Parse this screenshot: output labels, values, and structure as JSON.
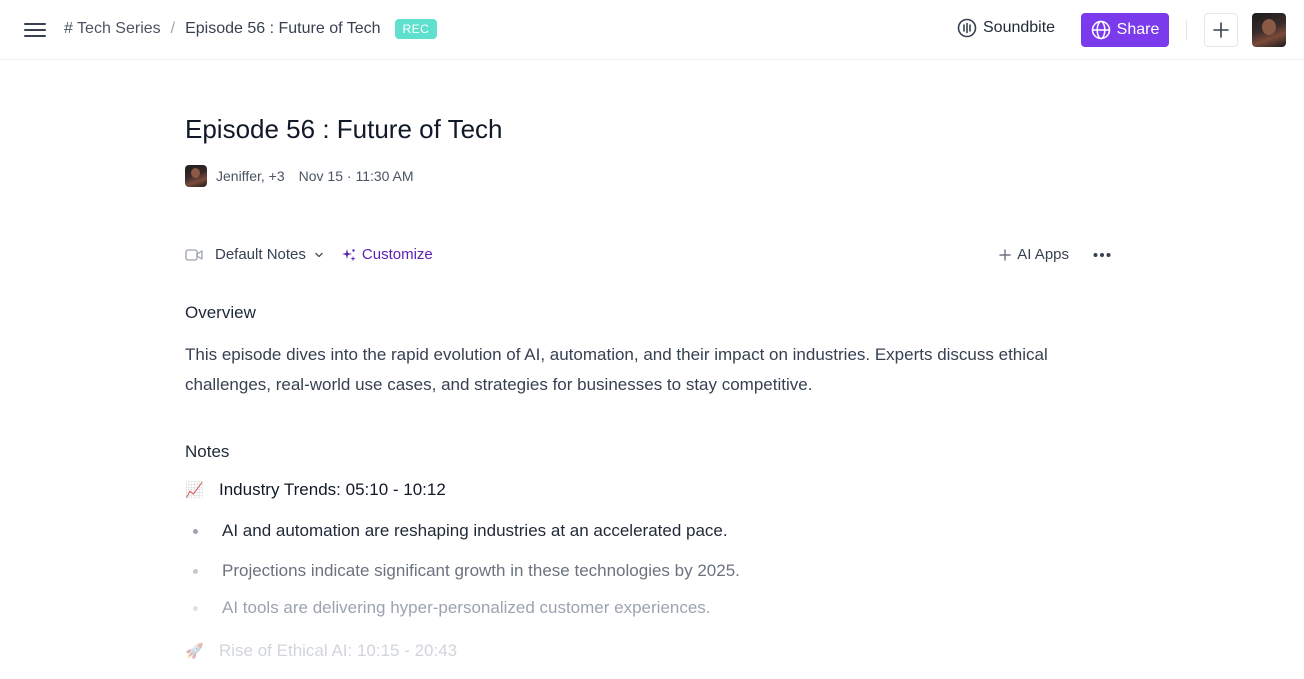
{
  "topbar": {
    "breadcrumb_series": "# Tech Series",
    "breadcrumb_separator": "/",
    "breadcrumb_episode": "Episode 56 : Future of Tech",
    "rec_badge": "REC",
    "soundbite_label": "Soundbite",
    "share_label": "Share",
    "icons": [
      "menu-icon",
      "soundbite-icon",
      "globe-icon",
      "plus-icon",
      "avatar"
    ]
  },
  "doc": {
    "title": "Episode 56 : Future of Tech",
    "participants": "Jeniffer, +3",
    "date": "Nov 15 · 11:30 AM"
  },
  "toolbar": {
    "template_label": "Default Notes",
    "customize_label": "Customize",
    "ai_apps_label": "AI Apps",
    "more_icon": "more-horizontal-icon"
  },
  "overview": {
    "heading": "Overview",
    "text": "This episode dives into the rapid evolution of AI, automation, and their impact on industries. Experts discuss ethical challenges, real-world use cases, and strategies for businesses to stay competitive."
  },
  "notes": {
    "heading": "Notes",
    "topics": [
      {
        "emoji": "📈",
        "title": "Industry Trends: 05:10 - 10:12",
        "bullets": [
          "AI and automation are reshaping industries at an accelerated pace.",
          "Projections indicate significant growth in these technologies by 2025.",
          "AI tools are delivering hyper-personalized customer experiences."
        ]
      },
      {
        "emoji": "🚀",
        "title": "Rise of Ethical AI: 10:15 - 20:43",
        "bullets": []
      }
    ]
  },
  "colors": {
    "accent": "#7c3aed",
    "rec_badge": "#5fe0cf",
    "customize_text": "#5b21b6"
  }
}
